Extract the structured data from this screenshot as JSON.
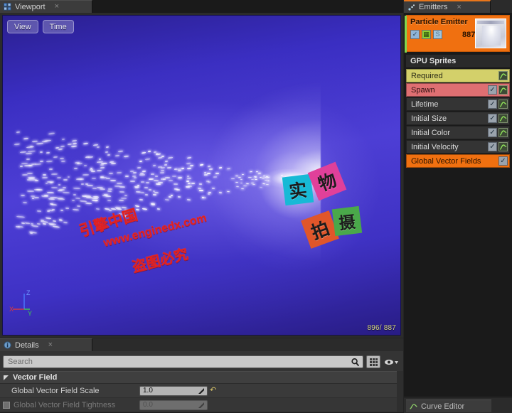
{
  "viewport": {
    "tab_label": "Viewport",
    "tab_icon": "grid-viewport-icon",
    "close_label": "×",
    "toolbar": {
      "view_label": "View",
      "time_label": "Time"
    },
    "particle_counter": "896/ 887",
    "gizmo": {
      "x_label": "X",
      "y_label": "Y",
      "z_label": "Z",
      "x_color": "#e03b3b",
      "y_color": "#3fd04a",
      "z_color": "#4a7bff"
    },
    "background_color": "#4437cc",
    "watermark": {
      "line1": "引擎中国",
      "line2": "www.enginedx.com",
      "line3": "盗图必究",
      "color": "#e02020",
      "tiles": [
        {
          "char": "实",
          "color": "#17b9d6"
        },
        {
          "char": "物",
          "color": "#e0409a"
        },
        {
          "char": "拍",
          "color": "#e0562a"
        },
        {
          "char": "摄",
          "color": "#4aa84a"
        }
      ]
    }
  },
  "details": {
    "tab_label": "Details",
    "tab_icon": "info-details-icon",
    "close_label": "×",
    "search": {
      "placeholder": "Search",
      "icon": "magnifier-icon"
    },
    "toolbar_buttons": [
      {
        "name": "grid-view-button",
        "icon": "grid-icon"
      },
      {
        "name": "visibility-button",
        "icon": "eye-dropdown-icon"
      }
    ],
    "category": {
      "label": "Vector Field",
      "expanded": true
    },
    "properties": [
      {
        "label": "Global Vector Field Scale",
        "value": "1.0",
        "enabled": true,
        "has_checkbox": false,
        "has_revert": true
      },
      {
        "label": "Global Vector Field Tightness",
        "value": "0.0",
        "enabled": false,
        "has_checkbox": true,
        "has_revert": false
      }
    ]
  },
  "emitters": {
    "tab_label": "Emitters",
    "tab_icon": "emitters-icon",
    "close_label": "×",
    "emitter": {
      "name": "Particle Emitter",
      "count": "887",
      "selected": true,
      "header_color": "#f07010",
      "icons": [
        {
          "name": "enabled-checkbox",
          "glyph": "✓",
          "color": "#8fb4d8",
          "state": "checked"
        },
        {
          "name": "render-mode-icon",
          "glyph": "▦",
          "color": "#8fd030",
          "state": "active"
        },
        {
          "name": "solo-icon",
          "glyph": "S",
          "color": "#9fc4dc",
          "state": "disabled"
        }
      ],
      "thumbnail": "emitter-thumbnail"
    },
    "type_header": "GPU Sprites",
    "modules": [
      {
        "label": "Required",
        "bg": "#d3d06a",
        "text": "#2a2a16",
        "checkbox": false,
        "curve": true
      },
      {
        "label": "Spawn",
        "bg": "#df6f72",
        "text": "#2d1111",
        "checkbox": true,
        "curve": true
      },
      {
        "label": "Lifetime",
        "bg": "#343434",
        "text": "#dcdcdc",
        "checkbox": true,
        "curve": true
      },
      {
        "label": "Initial Size",
        "bg": "#343434",
        "text": "#dcdcdc",
        "checkbox": true,
        "curve": true
      },
      {
        "label": "Initial Color",
        "bg": "#343434",
        "text": "#dcdcdc",
        "checkbox": true,
        "curve": true
      },
      {
        "label": "Initial Velocity",
        "bg": "#343434",
        "text": "#dcdcdc",
        "checkbox": true,
        "curve": true
      },
      {
        "label": "Global Vector Fields",
        "bg": "#f07010",
        "text": "#2a1300",
        "checkbox": true,
        "curve": false
      }
    ]
  },
  "curve_editor": {
    "tab_label": "Curve Editor",
    "tab_icon": "curve-editor-icon"
  }
}
